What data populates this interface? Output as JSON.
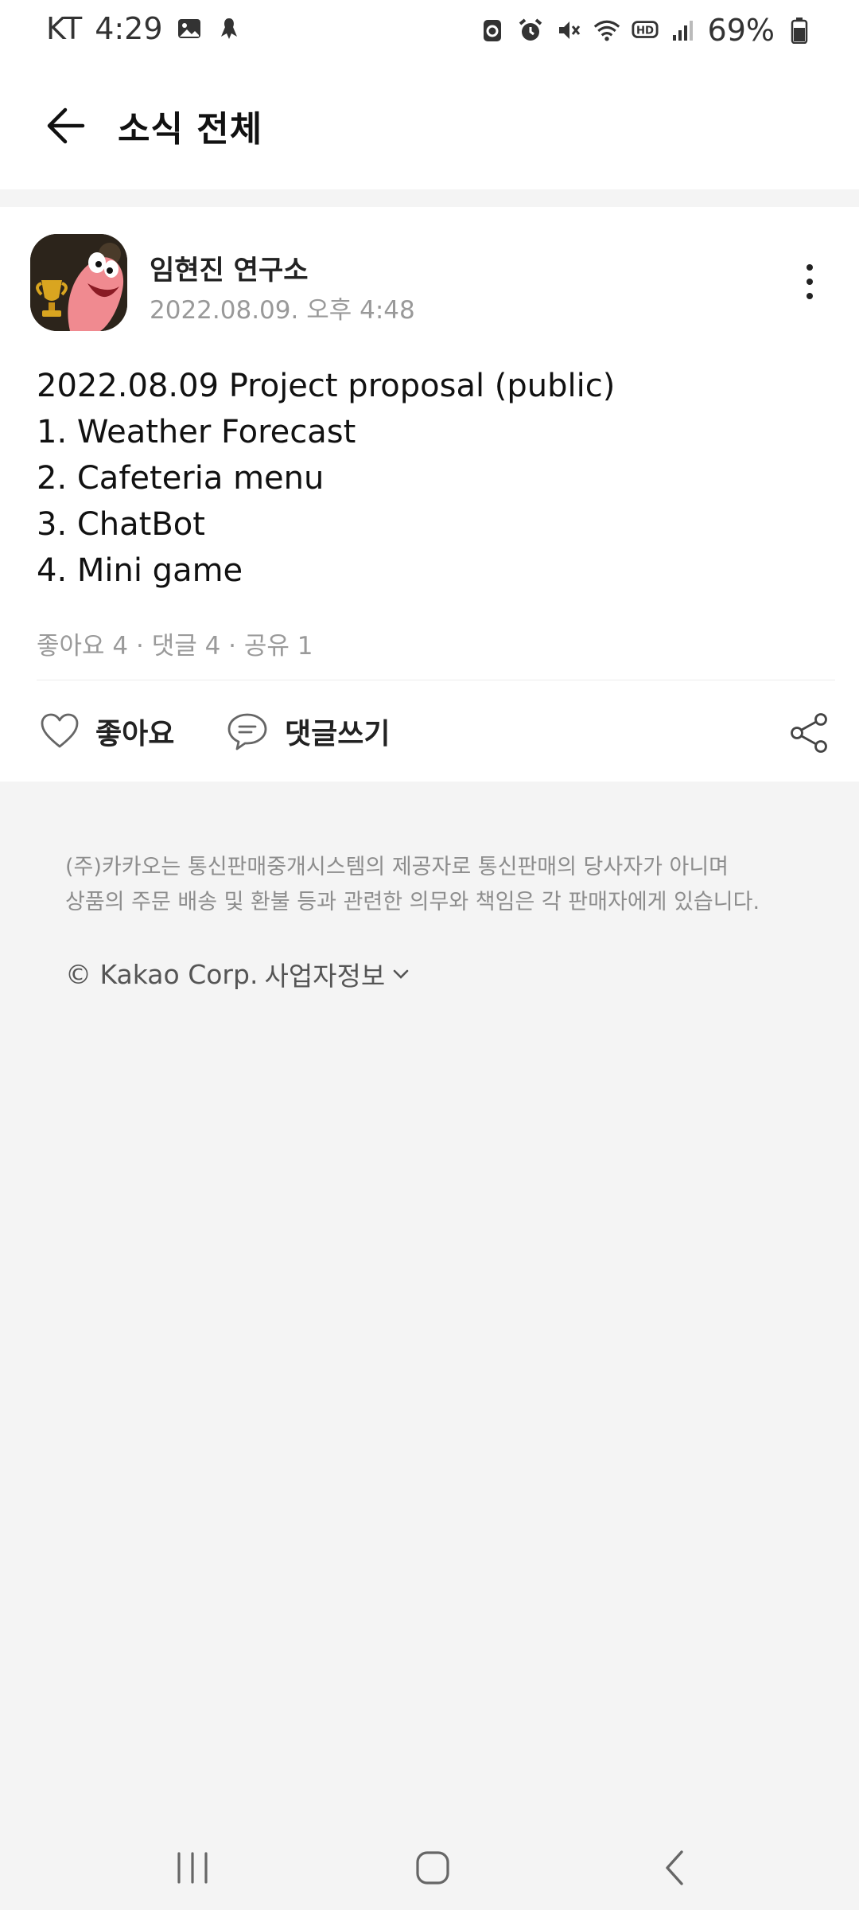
{
  "status_bar": {
    "carrier": "KT",
    "time": "4:29",
    "battery": "69%"
  },
  "header": {
    "title": "소식 전체"
  },
  "post": {
    "author": "임현진 연구소",
    "date": "2022.08.09. 오후 4:48",
    "title": "2022.08.09 Project proposal (public)",
    "lines": [
      "1. Weather Forecast",
      "2. Cafeteria menu",
      "3. ChatBot",
      "4. Mini game"
    ],
    "stats": "좋아요 4 · 댓글 4 · 공유 1",
    "like_label": "좋아요",
    "comment_label": "댓글쓰기"
  },
  "footer": {
    "notice_line1": "(주)카카오는 통신판매중개시스템의 제공자로 통신판매의 당사자가 아니며",
    "notice_line2": "상품의 주문 배송 및 환불 등과 관련한 의무와 책임은 각 판매자에게 있습니다.",
    "corp": "© Kakao Corp.",
    "business_info": "사업자정보"
  },
  "colors": {
    "background": "#f4f4f4",
    "card": "#ffffff",
    "muted_text": "#999999"
  },
  "icons": [
    "image-icon",
    "app-icon",
    "nfc-icon",
    "alarm-icon",
    "mute-icon",
    "wifi-icon",
    "hd-icon",
    "signal-icon",
    "battery-icon",
    "back-arrow-icon",
    "more-vertical-icon",
    "heart-icon",
    "comment-icon",
    "share-icon",
    "chevron-down-icon",
    "recents-icon",
    "home-icon",
    "back-icon"
  ]
}
